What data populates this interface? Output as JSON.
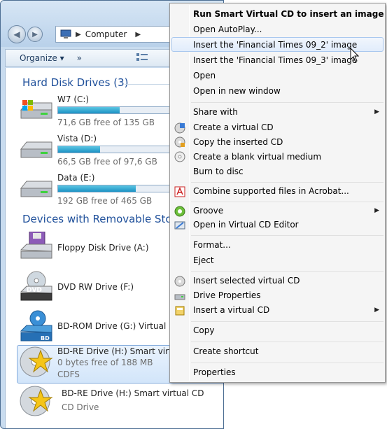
{
  "address": {
    "location": "Computer"
  },
  "toolbar": {
    "organize": "Organize",
    "more": "»"
  },
  "groups": {
    "hard_disk": "Hard Disk Drives (3)",
    "removable": "Devices with Removable Storag"
  },
  "drives": [
    {
      "name": "W7 (C:)",
      "free": "71,6 GB free of 135 GB",
      "used_fraction": 0.47
    },
    {
      "name": "Vista (D:)",
      "free": "66,5 GB free of 97,6 GB",
      "used_fraction": 0.32
    },
    {
      "name": "Data (E:)",
      "free": "192 GB free of 465 GB",
      "used_fraction": 0.59
    }
  ],
  "removable": [
    {
      "name": "Floppy Disk Drive (A:)",
      "sub": "",
      "sub2": ""
    },
    {
      "name": "DVD RW Drive (F:)",
      "sub": "",
      "sub2": ""
    },
    {
      "name": "BD-ROM Drive (G:) Virtual BD o",
      "sub": "",
      "sub2": ""
    },
    {
      "name": "BD-RE Drive (H:) Smart virtual C",
      "sub": "0 bytes free of 188 MB",
      "sub2": "CDFS"
    },
    {
      "name": "BD-RE Drive (H:) Smart virtual CD",
      "sub": "CD Drive",
      "sub2": ""
    }
  ],
  "menu": {
    "items": [
      "Run Smart Virtual CD to insert an image",
      "Open AutoPlay...",
      "Insert the 'Financial Times 09_2' image",
      "Insert the 'Financial Times 09_3' image",
      "Open",
      "Open in new window",
      "Share with",
      "Create a virtual CD",
      "Copy the inserted CD",
      "Create a blank virtual medium",
      "Burn to disc",
      "Combine supported files in Acrobat...",
      "Groove",
      "Open in Virtual CD Editor",
      "Format...",
      "Eject",
      "Insert selected virtual CD",
      "Drive Properties",
      "Insert a virtual CD",
      "Copy",
      "Create shortcut",
      "Properties"
    ],
    "submenu_arrow": "▶"
  },
  "icons": {
    "back": "back-arrow-icon",
    "forward": "forward-arrow-icon",
    "computer": "computer-icon",
    "views": "views-icon"
  }
}
